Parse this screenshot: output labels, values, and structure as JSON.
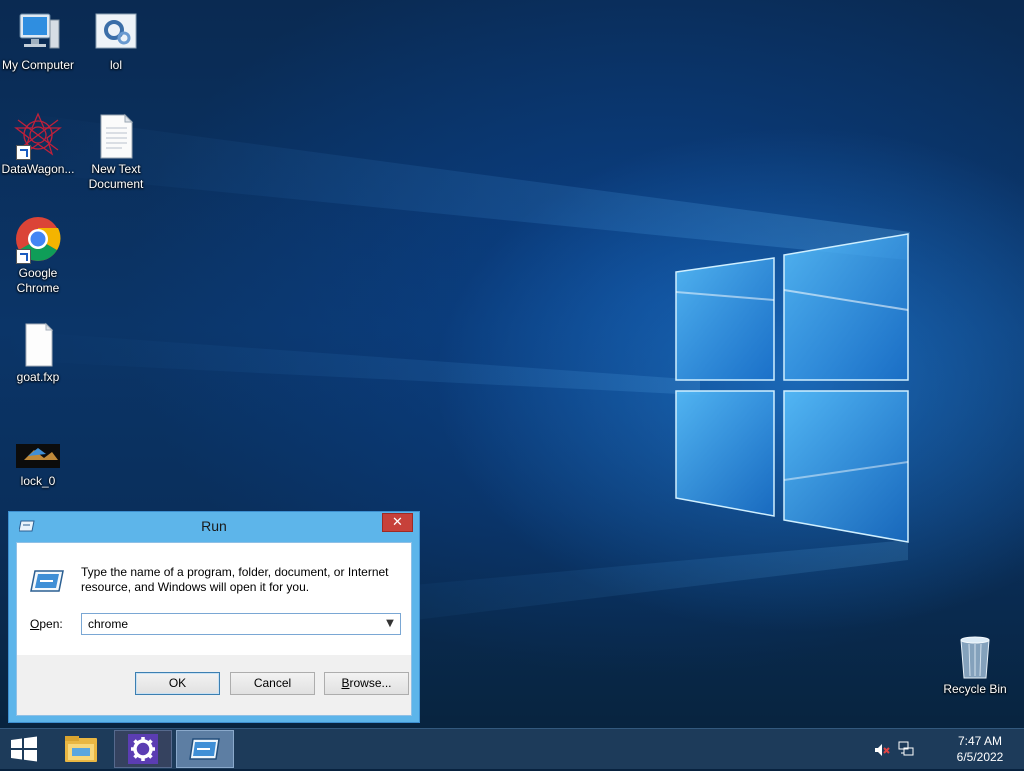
{
  "desktop": {
    "icons": [
      {
        "label": "My Computer",
        "icon": "computer-icon"
      },
      {
        "label": "lol",
        "icon": "settings-file-icon"
      },
      {
        "label": "DataWagon...",
        "icon": "datawagon-icon"
      },
      {
        "label": "New Text Document",
        "icon": "text-document-icon"
      },
      {
        "label": "Google Chrome",
        "icon": "chrome-icon"
      },
      {
        "label": "goat.fxp",
        "icon": "blank-file-icon"
      },
      {
        "label": "lock_0",
        "icon": "image-file-icon"
      },
      {
        "label": "Recycle Bin",
        "icon": "recycle-bin-icon"
      }
    ]
  },
  "run_dialog": {
    "title": "Run",
    "close_symbol": "✕",
    "description": "Type the name of a program, folder, document, or Internet resource, and Windows will open it for you.",
    "open_label_accel": "O",
    "open_label_rest": "pen:",
    "open_value": "chrome",
    "buttons": {
      "ok": "OK",
      "cancel": "Cancel",
      "browse_accel": "B",
      "browse_rest": "rowse..."
    }
  },
  "taskbar": {
    "items": [
      "start-icon",
      "file-explorer-icon",
      "control-panel-icon",
      "run-icon"
    ],
    "tray": [
      "volume-muted-icon",
      "network-icon"
    ],
    "clock": {
      "time": "7:47 AM",
      "date": "6/5/2022"
    }
  },
  "colors": {
    "taskbar": "#1d3b5a",
    "dialog_frame": "#5db5ea",
    "close_button": "#c7413a",
    "wallpaper_glow": "#1f8fe6"
  }
}
